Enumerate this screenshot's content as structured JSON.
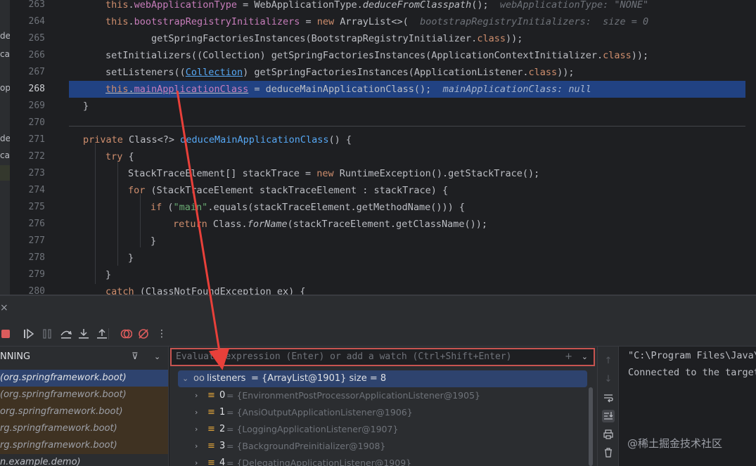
{
  "left_strip": {
    "fragments": [
      "de",
      "ca",
      "op",
      "de",
      "ca"
    ]
  },
  "code_lines": [
    {
      "num": "263",
      "parts": [
        {
          "t": "this",
          "c": "kw"
        },
        {
          "t": ".",
          "c": ""
        },
        {
          "t": "webApplicationType",
          "c": "fld"
        },
        {
          "t": " = WebApplicationType.",
          "c": ""
        },
        {
          "t": "deduceFromClasspath",
          "c": "ital"
        },
        {
          "t": "();  ",
          "c": ""
        },
        {
          "t": "webApplicationType: \"NONE\"",
          "c": "hint"
        }
      ]
    },
    {
      "num": "264",
      "parts": [
        {
          "t": "this",
          "c": "kw"
        },
        {
          "t": ".",
          "c": ""
        },
        {
          "t": "bootstrapRegistryInitializers",
          "c": "fld"
        },
        {
          "t": " = ",
          "c": ""
        },
        {
          "t": "new ",
          "c": "kw"
        },
        {
          "t": "ArrayList<>(  ",
          "c": ""
        },
        {
          "t": "bootstrapRegistryInitializers:  size = 0",
          "c": "hint"
        }
      ]
    },
    {
      "num": "265",
      "parts": [
        {
          "t": "        getSpringFactoriesInstances(BootstrapRegistryInitializer.",
          "c": ""
        },
        {
          "t": "class",
          "c": "kw"
        },
        {
          "t": "));",
          "c": ""
        }
      ]
    },
    {
      "num": "266",
      "parts": [
        {
          "t": "setInitializers((Collection) getSpringFactoriesInstances(ApplicationContextInitializer.",
          "c": ""
        },
        {
          "t": "class",
          "c": "kw"
        },
        {
          "t": "));",
          "c": ""
        }
      ]
    },
    {
      "num": "267",
      "parts": [
        {
          "t": "setListeners((",
          "c": ""
        },
        {
          "t": "Collection",
          "c": "link"
        },
        {
          "t": ") getSpringFactoriesInstances(ApplicationListener.",
          "c": ""
        },
        {
          "t": "class",
          "c": "kw"
        },
        {
          "t": "));",
          "c": ""
        }
      ]
    },
    {
      "num": "268",
      "active": true,
      "parts": [
        {
          "t": "this",
          "c": "kw sel-under"
        },
        {
          "t": ".",
          "c": "sel-under"
        },
        {
          "t": "mainApplicationClass",
          "c": "fld sel-under"
        },
        {
          "t": " = deduceMainApplicationClass();  ",
          "c": ""
        },
        {
          "t": "mainApplicationClass: null",
          "c": "hint-act"
        }
      ]
    },
    {
      "num": "269",
      "parts": [
        {
          "t": "}",
          "c": ""
        }
      ]
    },
    {
      "num": "270",
      "parts": []
    },
    {
      "num": "271",
      "parts": [
        {
          "t": "private ",
          "c": "kw"
        },
        {
          "t": "Class<?> ",
          "c": ""
        },
        {
          "t": "deduceMainApplicationClass",
          "c": "mth"
        },
        {
          "t": "() {",
          "c": ""
        }
      ]
    },
    {
      "num": "272",
      "parts": [
        {
          "t": "try ",
          "c": "kw"
        },
        {
          "t": "{",
          "c": ""
        }
      ]
    },
    {
      "num": "273",
      "parts": [
        {
          "t": "StackTraceElement[] ",
          "c": ""
        },
        {
          "t": "stackTrace",
          "c": ""
        },
        {
          "t": " = ",
          "c": ""
        },
        {
          "t": "new ",
          "c": "kw"
        },
        {
          "t": "RuntimeException().getStackTrace();",
          "c": ""
        }
      ]
    },
    {
      "num": "274",
      "parts": [
        {
          "t": "for ",
          "c": "kw"
        },
        {
          "t": "(StackTraceElement stackTraceElement : stackTrace) {",
          "c": ""
        }
      ]
    },
    {
      "num": "275",
      "parts": [
        {
          "t": "if ",
          "c": "kw"
        },
        {
          "t": "(",
          "c": ""
        },
        {
          "t": "\"main\"",
          "c": "str"
        },
        {
          "t": ".equals(stackTraceElement.getMethodName())) {",
          "c": ""
        }
      ]
    },
    {
      "num": "276",
      "parts": [
        {
          "t": "return ",
          "c": "kw"
        },
        {
          "t": "Class.",
          "c": ""
        },
        {
          "t": "forName",
          "c": "ital"
        },
        {
          "t": "(stackTraceElement.getClassName());",
          "c": ""
        }
      ]
    },
    {
      "num": "277",
      "parts": [
        {
          "t": "}",
          "c": ""
        }
      ]
    },
    {
      "num": "278",
      "parts": [
        {
          "t": "}",
          "c": ""
        }
      ]
    },
    {
      "num": "279",
      "parts": [
        {
          "t": "}",
          "c": ""
        }
      ]
    },
    {
      "num": "280",
      "parts": [
        {
          "t": "catch ",
          "c": "kw"
        },
        {
          "t": "(ClassNotFoundException ex) {",
          "c": ""
        }
      ]
    }
  ],
  "debug": {
    "close_glyph": "×",
    "toolbar_icons": [
      "stop-icon",
      "resume-icon",
      "pause-icon",
      "step-over-icon",
      "step-into-icon",
      "step-out-icon",
      "view-breakpoints-icon",
      "mute-breakpoints-icon",
      "more-icon"
    ],
    "frames": {
      "thread_label": "NNING",
      "filter_glyph": "⊽",
      "chevron_glyph": "⌄",
      "items": [
        {
          "text": "(org.springframework.boot)",
          "kind": "sel"
        },
        {
          "text": "(org.springframework.boot)",
          "kind": "lib"
        },
        {
          "text": "org.springframework.boot)",
          "kind": "lib"
        },
        {
          "text": "rg.springframework.boot)",
          "kind": "lib"
        },
        {
          "text": "rg.springframework.boot)",
          "kind": "lib"
        },
        {
          "text": "n.example.demo)",
          "kind": "user"
        }
      ]
    },
    "watches": {
      "placeholder": "Evaluate expression (Enter) or add a watch (Ctrl+Shift+Enter)",
      "add_watch_glyph": "+",
      "dropdown_glyph": "⌄",
      "root": {
        "name": "listeners",
        "value": " = {ArrayList@1901}  size = 8"
      },
      "children": [
        {
          "name": "0",
          "value": " = {EnvironmentPostProcessorApplicationListener@1905}"
        },
        {
          "name": "1",
          "value": " = {AnsiOutputApplicationListener@1906}"
        },
        {
          "name": "2",
          "value": " = {LoggingApplicationListener@1907}"
        },
        {
          "name": "3",
          "value": " = {BackgroundPreinitializer@1908}"
        },
        {
          "name": "4",
          "value": " = {DelegatingApplicationListener@1909}"
        }
      ]
    },
    "side_icons": [
      "up-arrow-icon",
      "down-arrow-icon",
      "soft-wrap-icon",
      "scroll-to-end-icon",
      "print-icon",
      "trash-icon"
    ],
    "console": {
      "lines": [
        "\"C:\\Program Files\\Java\\",
        "Connected to the target"
      ]
    },
    "watermark": "@稀土掘金技术社区"
  },
  "colors": {
    "highlight_line": "#214283",
    "error_border": "#c75450",
    "annotation_arrow": "#e8403a"
  }
}
